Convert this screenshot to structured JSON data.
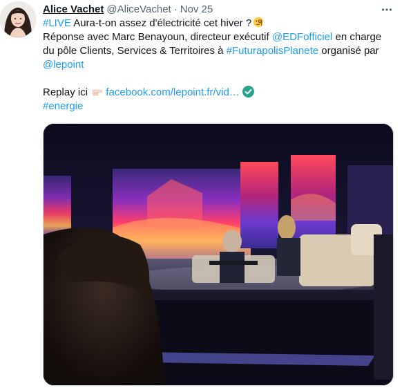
{
  "author": {
    "name": "Alice Vachet",
    "handle": "@AliceVachet",
    "separator": "·",
    "date": "Nov 25"
  },
  "tweet": {
    "line1_hashtag": "#LIVE",
    "line1_text": " Aura-t-on assez d'électricité cet hiver ?",
    "line2_text": "Réponse avec Marc Benayoun, directeur exécutif ",
    "line2_mention": "@EDFofficiel",
    "line2_tail": " en charge",
    "line3_text": "du pôle Clients, Services & Territoires à ",
    "line3_hashtag": "#FuturapolisPlanete",
    "line3_tail": " organisé par",
    "line4_mention": "@lepoint",
    "line5_text": "Replay ici ",
    "line5_link": "facebook.com/lepoint.fr/vid…",
    "line6_hashtag": "#energie"
  },
  "icons": {
    "more": "more-horizontal-icon",
    "thinking_emoji": "face-with-monocle-emoji",
    "pointing_emoji": "backhand-index-pointing-right-emoji",
    "verified": "check-circle-icon"
  },
  "colors": {
    "link": "#1d9bf0",
    "secondary_text": "#536471",
    "primary_text": "#0f1419",
    "check": "#2aa38b"
  }
}
